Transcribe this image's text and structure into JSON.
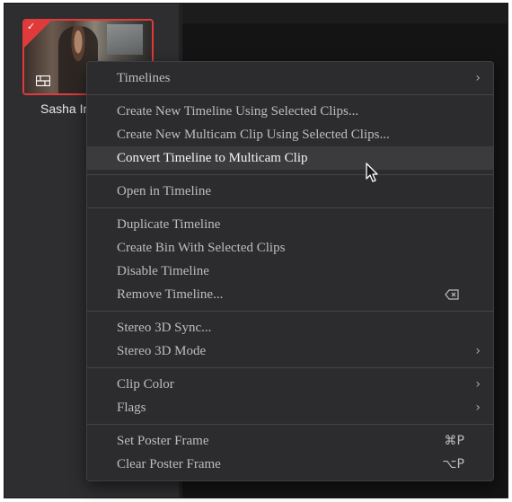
{
  "clip": {
    "name": "Sasha In",
    "border_color": "#e03a3a",
    "selected_icon": "checkmark-icon",
    "type_icon": "timeline-icon"
  },
  "menu": {
    "timelines": "Timelines",
    "create_new_timeline": "Create New Timeline Using Selected Clips...",
    "create_new_multicam": "Create New Multicam Clip Using Selected Clips...",
    "convert_to_multicam": "Convert Timeline to Multicam Clip",
    "open_in_timeline": "Open in Timeline",
    "duplicate_timeline": "Duplicate Timeline",
    "create_bin": "Create Bin With Selected Clips",
    "disable_timeline": "Disable Timeline",
    "remove_timeline": "Remove Timeline...",
    "stereo_sync": "Stereo 3D Sync...",
    "stereo_mode": "Stereo 3D Mode",
    "clip_color": "Clip Color",
    "flags": "Flags",
    "set_poster_frame": "Set Poster Frame",
    "set_poster_shortcut": "⌘P",
    "clear_poster_frame": "Clear Poster Frame",
    "clear_poster_shortcut": "⌥P",
    "submenu_arrow": "›",
    "highlighted_item": "convert_to_multicam"
  },
  "colors": {
    "menu_bg": "#2c2c2e",
    "highlight_bg": "#3b3b3e",
    "selection_red": "#e03a3a"
  }
}
